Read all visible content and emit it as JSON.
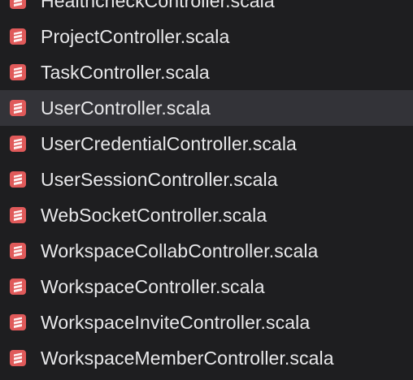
{
  "file_list": {
    "icon": "scala-file-icon",
    "accent_color": "#e05a5a",
    "items": [
      {
        "name": "HealthcheckController.scala",
        "selected": false
      },
      {
        "name": "ProjectController.scala",
        "selected": false
      },
      {
        "name": "TaskController.scala",
        "selected": false
      },
      {
        "name": "UserController.scala",
        "selected": true
      },
      {
        "name": "UserCredentialController.scala",
        "selected": false
      },
      {
        "name": "UserSessionController.scala",
        "selected": false
      },
      {
        "name": "WebSocketController.scala",
        "selected": false
      },
      {
        "name": "WorkspaceCollabController.scala",
        "selected": false
      },
      {
        "name": "WorkspaceController.scala",
        "selected": false
      },
      {
        "name": "WorkspaceInviteController.scala",
        "selected": false
      },
      {
        "name": "WorkspaceMemberController.scala",
        "selected": false
      }
    ]
  }
}
